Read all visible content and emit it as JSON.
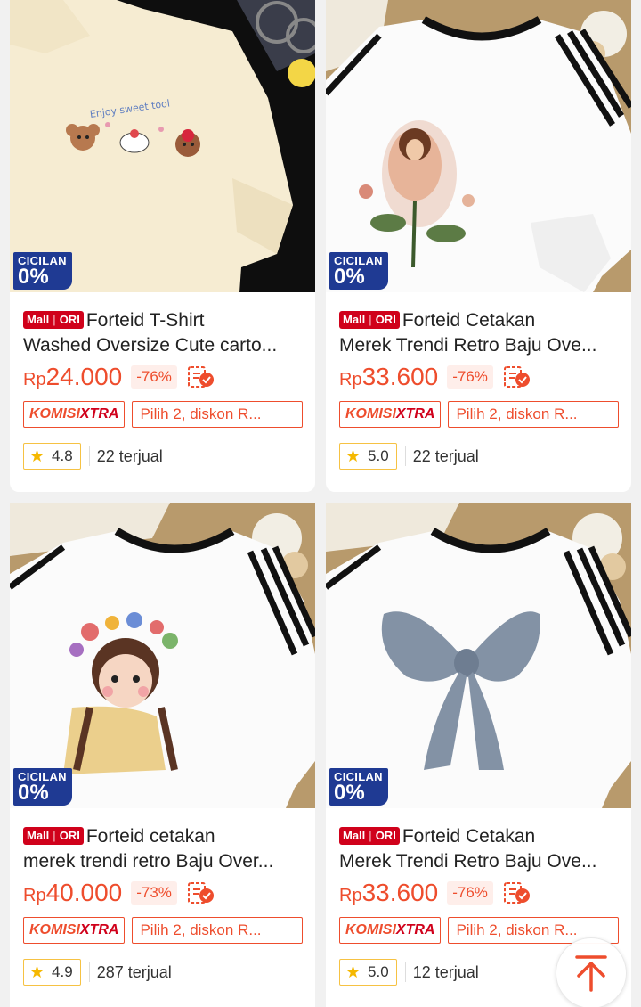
{
  "badges": {
    "cicilan_line1": "CICILAN",
    "cicilan_line2": "0%",
    "mall": "Mall",
    "ori": "ORI"
  },
  "tags": {
    "komisi_part1": "KOMISI",
    "komisi_part2": "XTRA",
    "promo": "Pilih 2, diskon R..."
  },
  "colors": {
    "accent": "#ee4d2d",
    "mall_red": "#d0011b",
    "cicilan_blue": "#1f3a93",
    "star": "#f5b800"
  },
  "products": [
    {
      "title_line1": "Forteid T-Shirt",
      "title_line2": "Washed Oversize Cute carto...",
      "price_prefix": "Rp",
      "price": "24.000",
      "discount": "-76%",
      "rating": "4.8",
      "sold": "22 terjual",
      "image_icon": "cream-tshirt-cartoon-print"
    },
    {
      "title_line1": "Forteid Cetakan",
      "title_line2": "Merek Trendi Retro Baju Ove...",
      "price_prefix": "Rp",
      "price": "33.600",
      "discount": "-76%",
      "rating": "5.0",
      "sold": "22 terjual",
      "image_icon": "white-tshirt-flower-girl"
    },
    {
      "title_line1": "Forteid cetakan",
      "title_line2": "merek trendi retro Baju Over...",
      "price_prefix": "Rp",
      "price": "40.000",
      "discount": "-73%",
      "rating": "4.9",
      "sold": "287 terjual",
      "image_icon": "white-tshirt-flower-crown-girl"
    },
    {
      "title_line1": "Forteid Cetakan",
      "title_line2": "Merek Trendi Retro Baju Ove...",
      "price_prefix": "Rp",
      "price": "33.600",
      "discount": "-76%",
      "rating": "5.0",
      "sold": "12 terjual",
      "image_icon": "white-tshirt-blue-bow"
    }
  ],
  "fab": {
    "icon": "arrow-up-to-top-icon"
  }
}
